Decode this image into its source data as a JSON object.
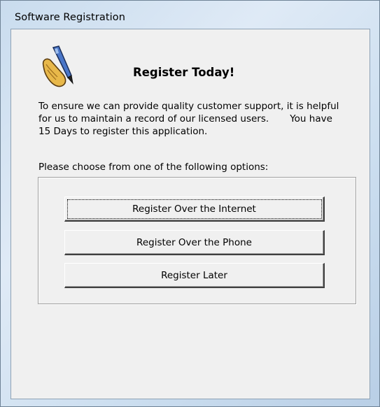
{
  "window": {
    "title": "Software Registration"
  },
  "dialog": {
    "logo_icon": "pen-writing-icon",
    "heading": "Register Today!",
    "paragraph_line1": "To ensure we can provide quality customer support, it is helpful",
    "paragraph_line2": "for us to maintain a record of our licensed users.       You have",
    "paragraph_line3": "15 Days to register this application.",
    "options_prompt": "Please choose from one of the following options:"
  },
  "options": {
    "internet_label": "Register Over the Internet",
    "phone_label": "Register Over the Phone",
    "later_label": "Register Later",
    "focused": "internet"
  }
}
